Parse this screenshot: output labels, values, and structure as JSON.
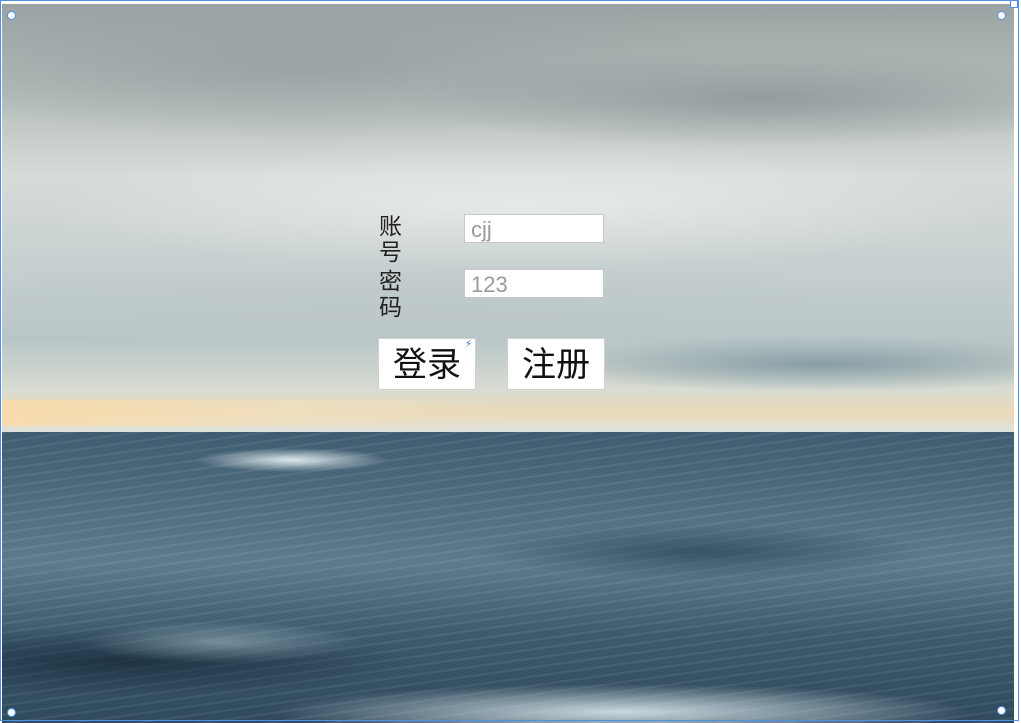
{
  "login_form": {
    "account_label": "账号",
    "account_value": "cjj",
    "password_label": "密码",
    "password_value": "123",
    "login_button": "登录",
    "register_button": "注册"
  },
  "icons": {
    "login_badge": "lightning-bolt-icon",
    "login_badge_glyph": "⚡"
  },
  "colors": {
    "selection_border": "#4f8fe6",
    "badge_color": "#2a7be4"
  }
}
